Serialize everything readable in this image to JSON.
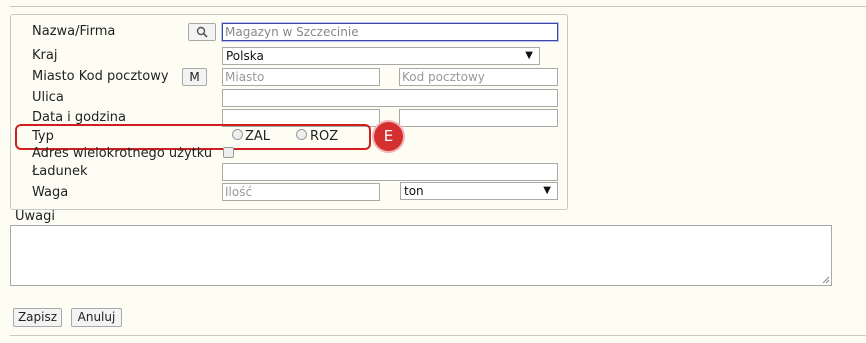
{
  "form": {
    "name_label": "Nazwa/Firma",
    "name_value": "Magazyn w Szczecinie",
    "country_label": "Kraj",
    "country_value": "Polska",
    "city_label": "Miasto Kod pocztowy",
    "map_button": "M",
    "city_placeholder": "Miasto",
    "postal_placeholder": "Kod pocztowy",
    "street_label": "Ulica",
    "datetime_label": "Data i godzina",
    "type_label": "Typ",
    "type_options": [
      "ZAL",
      "ROZ"
    ],
    "multi_address_label": "Adres wielokrotnego użytku",
    "cargo_label": "Ładunek",
    "weight_label": "Waga",
    "quantity_placeholder": "Ilość",
    "unit_value": "ton"
  },
  "notes_label": "Uwagi",
  "annotation": {
    "badge": "E",
    "color": "#d21e1e"
  },
  "buttons": {
    "save": "Zapisz",
    "cancel": "Anuluj"
  }
}
